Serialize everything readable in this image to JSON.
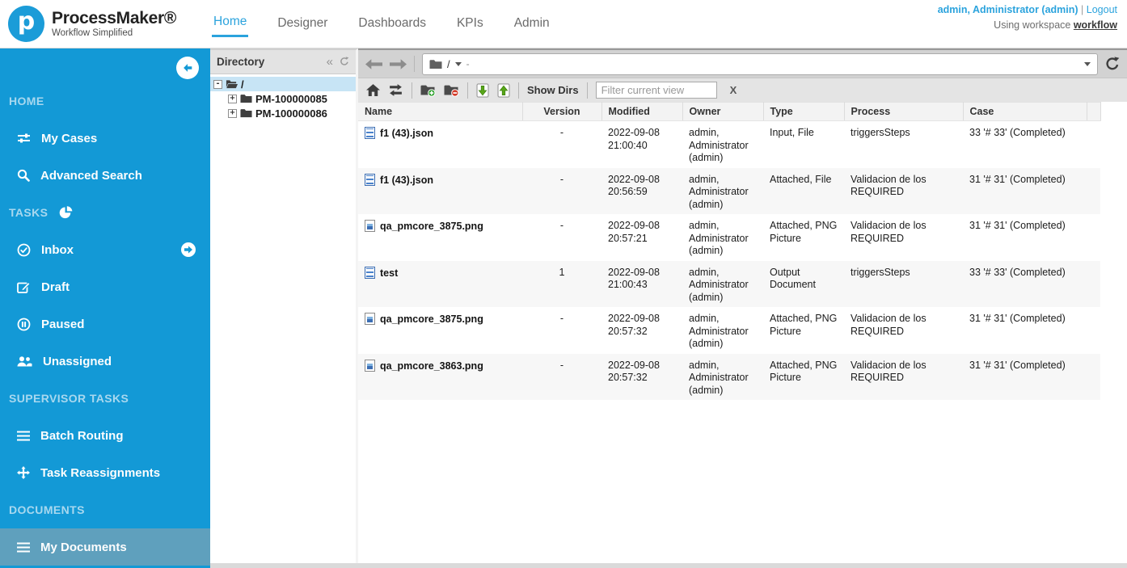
{
  "header": {
    "brand": {
      "title": "ProcessMaker®",
      "subtitle": "Workflow Simplified",
      "monogram": "p"
    },
    "nav": [
      {
        "label": "Home",
        "active": true
      },
      {
        "label": "Designer",
        "active": false
      },
      {
        "label": "Dashboards",
        "active": false
      },
      {
        "label": "KPIs",
        "active": false
      },
      {
        "label": "Admin",
        "active": false
      }
    ],
    "user": "admin, Administrator (admin)",
    "divider": "|",
    "logout": "Logout",
    "workspace_prefix": "Using workspace ",
    "workspace": "workflow"
  },
  "sidebar": {
    "section_home": "HOME",
    "my_cases": "My Cases",
    "advanced_search": "Advanced Search",
    "section_tasks": "TASKS",
    "inbox": "Inbox",
    "draft": "Draft",
    "paused": "Paused",
    "unassigned": "Unassigned",
    "section_supervisor": "SUPERVISOR TASKS",
    "batch_routing": "Batch Routing",
    "task_reassignments": "Task Reassignments",
    "section_documents": "DOCUMENTS",
    "my_documents": "My Documents"
  },
  "directory": {
    "title": "Directory",
    "root": "/",
    "folders": [
      "PM-100000085",
      "PM-100000086"
    ]
  },
  "breadcrumb": {
    "path": "/",
    "suffix": "-"
  },
  "toolbar": {
    "show_dirs": "Show Dirs",
    "filter_placeholder": "Filter current view",
    "filter_value": "",
    "clear": "X"
  },
  "table": {
    "columns": [
      "Name",
      "Version",
      "Modified",
      "Owner",
      "Type",
      "Process",
      "Case"
    ],
    "rows": [
      {
        "icon": "document",
        "name": "f1 (43).json",
        "version": "-",
        "modified": "2022-09-08 21:00:40",
        "owner": "admin, Administrator (admin)",
        "type": "Input, File",
        "process": "triggersSteps",
        "case": "33 '# 33' (Completed)"
      },
      {
        "icon": "document",
        "name": "f1 (43).json",
        "version": "-",
        "modified": "2022-09-08 20:56:59",
        "owner": "admin, Administrator (admin)",
        "type": "Attached, File",
        "process": "Validacion de los REQUIRED",
        "case": "31 '# 31' (Completed)"
      },
      {
        "icon": "image",
        "name": "qa_pmcore_3875.png",
        "version": "-",
        "modified": "2022-09-08 20:57:21",
        "owner": "admin, Administrator (admin)",
        "type": "Attached, PNG Picture",
        "process": "Validacion de los REQUIRED",
        "case": "31 '# 31' (Completed)"
      },
      {
        "icon": "document",
        "name": "test",
        "version": "1",
        "modified": "2022-09-08 21:00:43",
        "owner": "admin, Administrator (admin)",
        "type": "Output Document",
        "process": "triggersSteps",
        "case": "33 '# 33' (Completed)"
      },
      {
        "icon": "image",
        "name": "qa_pmcore_3875.png",
        "version": "-",
        "modified": "2022-09-08 20:57:32",
        "owner": "admin, Administrator (admin)",
        "type": "Attached, PNG Picture",
        "process": "Validacion de los REQUIRED",
        "case": "31 '# 31' (Completed)"
      },
      {
        "icon": "image",
        "name": "qa_pmcore_3863.png",
        "version": "-",
        "modified": "2022-09-08 20:57:32",
        "owner": "admin, Administrator (admin)",
        "type": "Attached, PNG Picture",
        "process": "Validacion de los REQUIRED",
        "case": "31 '# 31' (Completed)"
      }
    ]
  },
  "colors": {
    "sidebar_blue": "#1399d6",
    "accent_blue": "#2ba3dd",
    "active_item_bg": "#5fa0bd",
    "tree_selected_bg": "#c7e4f5",
    "toolbar_gray": "#d2d2d2"
  }
}
